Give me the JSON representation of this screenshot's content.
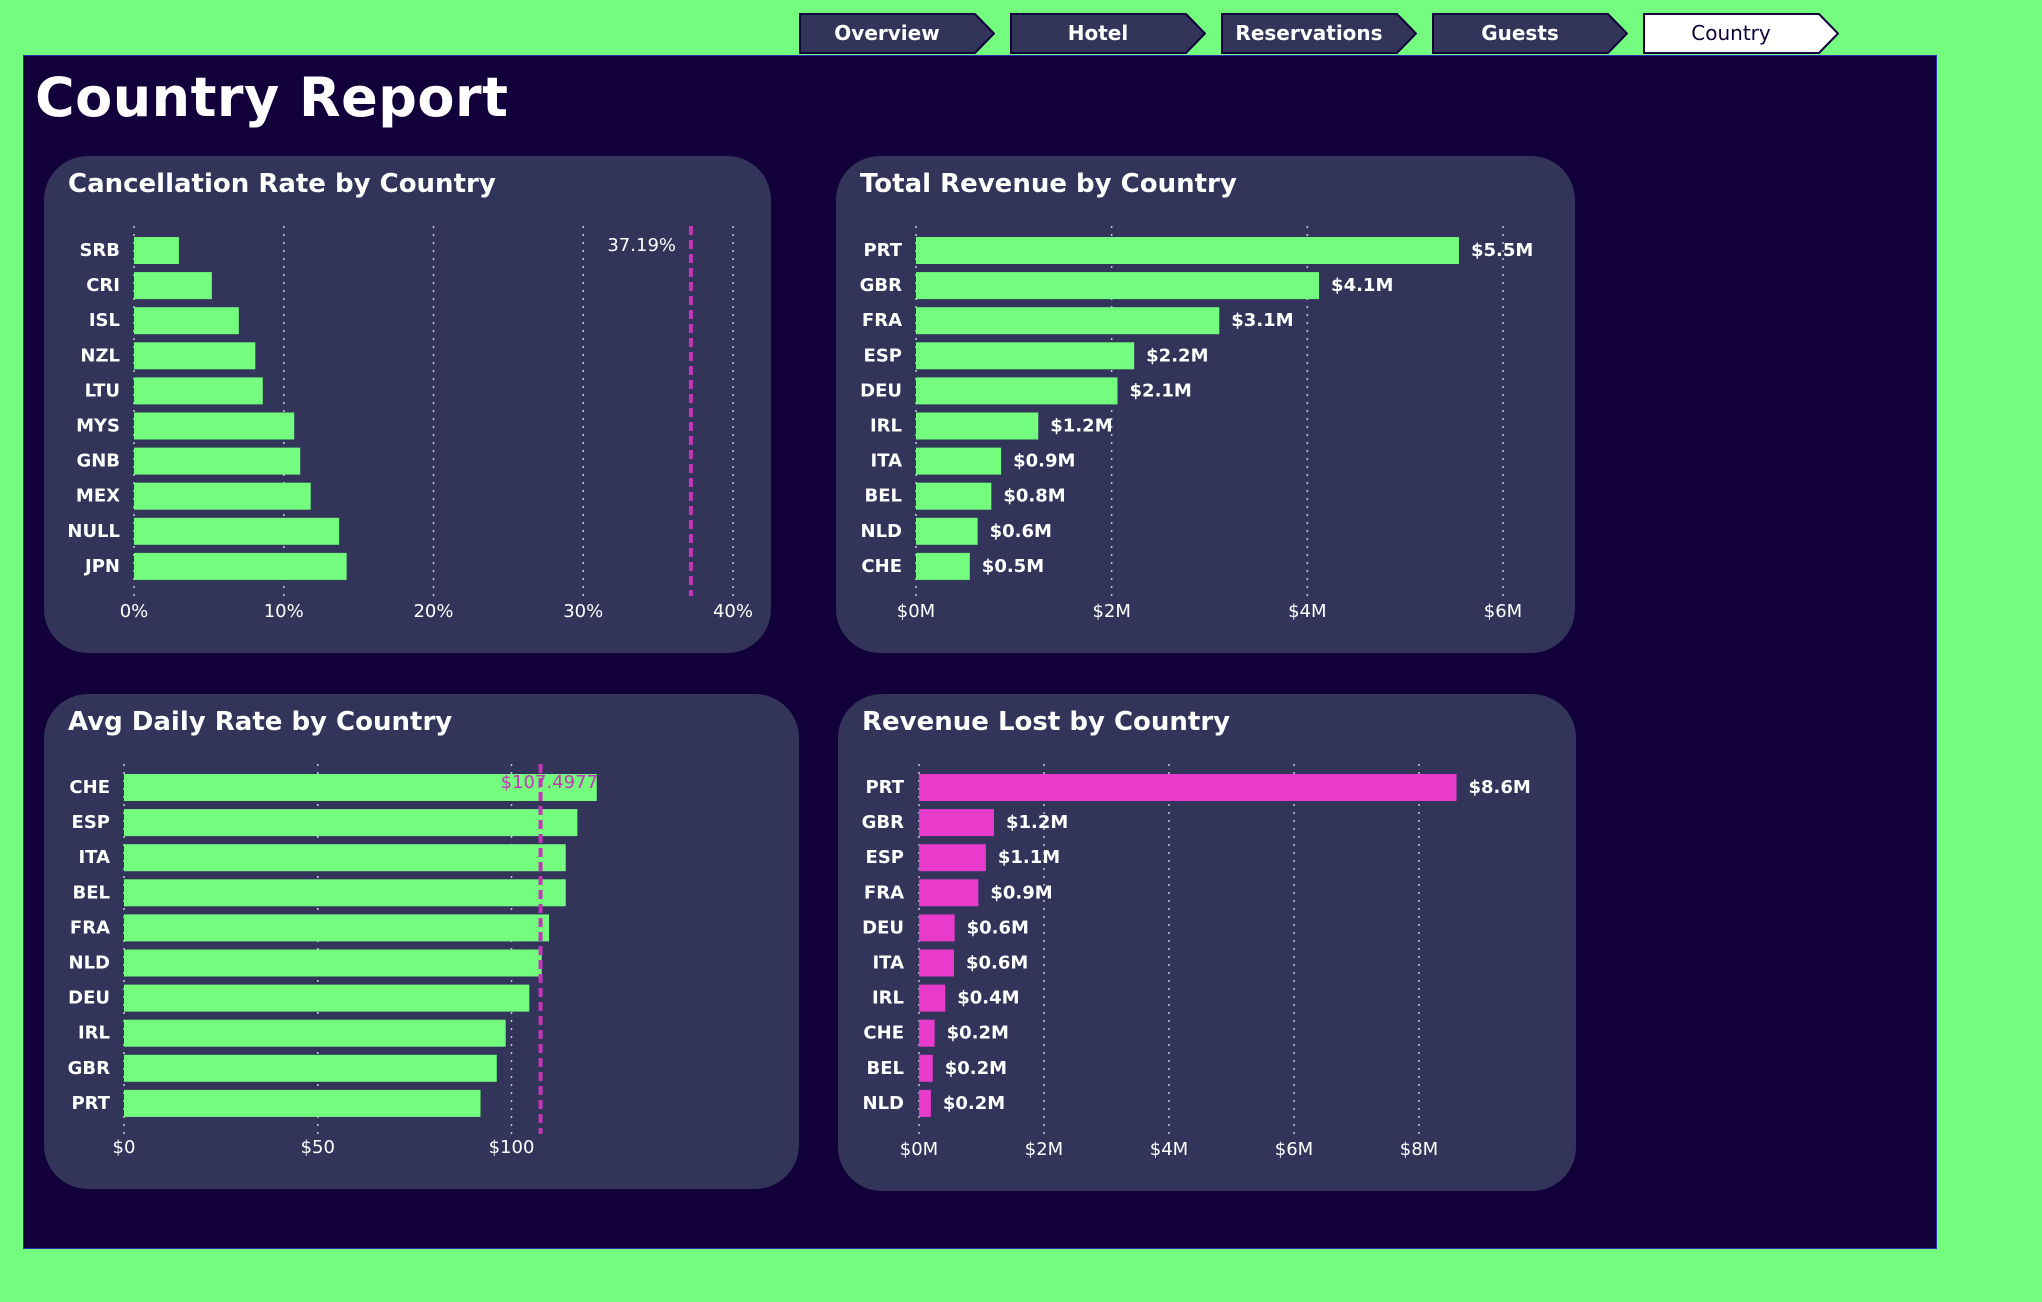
{
  "nav": {
    "tabs": [
      {
        "label": "Overview",
        "active": false
      },
      {
        "label": "Hotel",
        "active": false
      },
      {
        "label": "Reservations",
        "active": false
      },
      {
        "label": "Guests",
        "active": false
      },
      {
        "label": "Country",
        "active": true
      }
    ]
  },
  "page": {
    "title": "Country Report"
  },
  "colors": {
    "background": "#74FC7E",
    "canvas": "#12003A",
    "card": "#32345A",
    "green_bar": "#74FC7E",
    "magenta_bar": "#E83BCB",
    "reference_line": "#C436B7"
  },
  "chart_data": [
    {
      "id": "cancellation",
      "type": "bar",
      "orientation": "horizontal",
      "title": "Cancellation Rate by Country",
      "categories": [
        "SRB",
        "CRI",
        "ISL",
        "NZL",
        "LTU",
        "MYS",
        "GNB",
        "MEX",
        "NULL",
        "JPN"
      ],
      "values": [
        3.0,
        5.2,
        7.0,
        8.1,
        8.6,
        10.7,
        11.1,
        11.8,
        13.7,
        14.2
      ],
      "xlim": [
        0,
        40
      ],
      "ticks": [
        0,
        10,
        20,
        30,
        40
      ],
      "tick_labels": [
        "0%",
        "10%",
        "20%",
        "30%",
        "40%"
      ],
      "reference_value": 37.19,
      "reference_label": "37.19%",
      "data_labels": [],
      "bar_color": "#74FC7E",
      "grid": true
    },
    {
      "id": "revenue",
      "type": "bar",
      "orientation": "horizontal",
      "title": "Total Revenue by Country",
      "categories": [
        "PRT",
        "GBR",
        "FRA",
        "ESP",
        "DEU",
        "IRL",
        "ITA",
        "BEL",
        "NLD",
        "CHE"
      ],
      "values": [
        5.55,
        4.12,
        3.1,
        2.23,
        2.06,
        1.25,
        0.87,
        0.77,
        0.63,
        0.55
      ],
      "xlim": [
        0,
        6
      ],
      "ticks": [
        0,
        2,
        4,
        6
      ],
      "tick_labels": [
        "$0M",
        "$2M",
        "$4M",
        "$6M"
      ],
      "data_labels": [
        "$5.5M",
        "$4.1M",
        "$3.1M",
        "$2.2M",
        "$2.1M",
        "$1.2M",
        "$0.9M",
        "$0.8M",
        "$0.6M",
        "$0.5M"
      ],
      "bar_color": "#74FC7E",
      "grid": true
    },
    {
      "id": "adr",
      "type": "bar",
      "orientation": "horizontal",
      "title": "Avg Daily Rate by Country",
      "categories": [
        "CHE",
        "ESP",
        "ITA",
        "BEL",
        "FRA",
        "NLD",
        "DEU",
        "IRL",
        "GBR",
        "PRT"
      ],
      "values": [
        122,
        117,
        114,
        114,
        109.7,
        107.8,
        104.6,
        98.5,
        96.2,
        92
      ],
      "xlim": [
        0,
        135
      ],
      "ticks": [
        0,
        50,
        100
      ],
      "tick_labels": [
        "$0",
        "$50",
        "$100"
      ],
      "reference_value": 107.4977,
      "reference_label": "$107.4977",
      "data_labels": [],
      "bar_color": "#74FC7E",
      "grid": true
    },
    {
      "id": "lost",
      "type": "bar",
      "orientation": "horizontal",
      "title": "Revenue Lost by Country",
      "categories": [
        "PRT",
        "GBR",
        "ESP",
        "FRA",
        "DEU",
        "ITA",
        "IRL",
        "CHE",
        "BEL",
        "NLD"
      ],
      "values": [
        8.6,
        1.2,
        1.07,
        0.95,
        0.57,
        0.56,
        0.42,
        0.25,
        0.22,
        0.19
      ],
      "xlim": [
        0,
        9
      ],
      "ticks": [
        0,
        2,
        4,
        6,
        8
      ],
      "tick_labels": [
        "$0M",
        "$2M",
        "$4M",
        "$6M",
        "$8M"
      ],
      "data_labels": [
        "$8.6M",
        "$1.2M",
        "$1.1M",
        "$0.9M",
        "$0.6M",
        "$0.6M",
        "$0.4M",
        "$0.2M",
        "$0.2M",
        "$0.2M"
      ],
      "bar_color": "#E83BCB",
      "grid": true
    }
  ]
}
